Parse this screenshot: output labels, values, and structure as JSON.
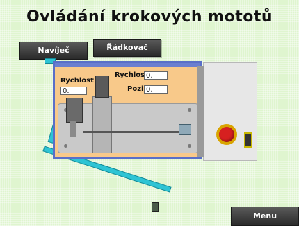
{
  "title": "Ovládání krokových mototů",
  "nav": {
    "navijec_label": "Navíječ",
    "radkovac_label": "Řádkovač",
    "menu_label": "Menu"
  },
  "machine": {
    "left_speed_label": "Rychlost",
    "left_speed_value": "0.",
    "speed_label": "Rychlost",
    "speed_value": "0.",
    "position_label": "Pozice",
    "position_value": "0."
  },
  "colors": {
    "background": "#dff5cf",
    "machine_frame": "#5a6fc8",
    "machine_body": "#f8c98a",
    "arm": "#2ec4d4",
    "estop": "#d62020"
  }
}
